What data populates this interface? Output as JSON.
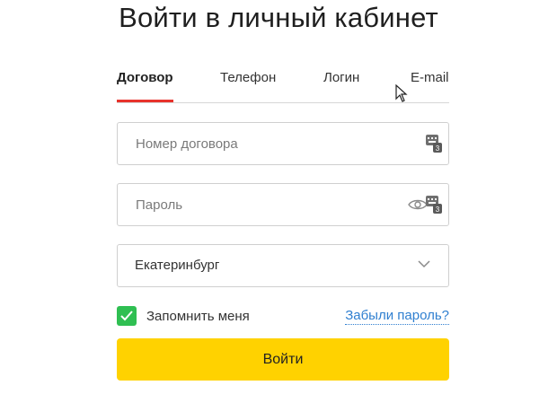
{
  "title": "Войти в личный кабинет",
  "tabs": [
    {
      "label": "Договор",
      "active": true
    },
    {
      "label": "Телефон",
      "active": false
    },
    {
      "label": "Логин",
      "active": false
    },
    {
      "label": "E-mail",
      "active": false
    }
  ],
  "contract_field": {
    "placeholder": "Номер договора",
    "value": ""
  },
  "password_field": {
    "placeholder": "Пароль",
    "value": ""
  },
  "city_select": {
    "value": "Екатеринбург"
  },
  "remember": {
    "label": "Запомнить меня",
    "checked": true
  },
  "forgot_link": "Забыли пароль?",
  "submit_label": "Войти",
  "icons": {
    "keyboard": "virtual-keyboard-icon",
    "eye": "show-password-icon",
    "chevron": "chevron-down-icon",
    "check": "checkmark-icon",
    "cursor": "mouse-cursor-icon"
  },
  "colors": {
    "accent_red": "#e8332c",
    "checkbox_green": "#2fbf52",
    "link_blue": "#2f7fd0",
    "button_yellow": "#ffd200"
  }
}
